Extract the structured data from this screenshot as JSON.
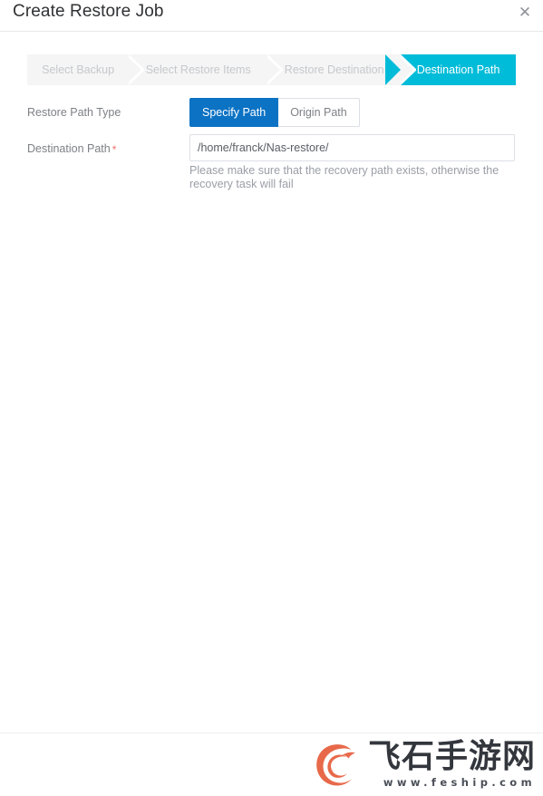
{
  "dialog": {
    "title": "Create Restore Job",
    "close_icon": "close-icon",
    "close_glyph": "✕"
  },
  "stepper": {
    "steps": [
      {
        "label": "Select Backup",
        "state": "inactive"
      },
      {
        "label": "Select Restore Items",
        "state": "inactive"
      },
      {
        "label": "Restore Destination",
        "state": "inactive"
      },
      {
        "label": "Destination Path",
        "state": "active"
      }
    ],
    "active_index": 3,
    "active_color": "#00bcd9",
    "inactive_bg": "#f5f5f5",
    "inactive_text_color": "#c6c8cc"
  },
  "form": {
    "restore_path_type": {
      "label": "Restore Path Type",
      "options": [
        {
          "label": "Specify Path",
          "selected": true
        },
        {
          "label": "Origin Path",
          "selected": false
        }
      ],
      "selected_value": "Specify Path",
      "selected_color": "#0b72c4"
    },
    "destination_path": {
      "label": "Destination Path",
      "required": true,
      "required_marker": "*",
      "required_color": "#f56c6c",
      "value": "/home/franck/Nas-restore/",
      "placeholder": "",
      "help_text": "Please make sure that the recovery path exists, otherwise the recovery task will fail"
    }
  },
  "watermark": {
    "logo_icon": "feship-bird-logo-icon",
    "brand_cn": "飞石手游网",
    "url": "www.feship.com",
    "logo_color": "#e8694a",
    "text_color": "#33373d"
  }
}
